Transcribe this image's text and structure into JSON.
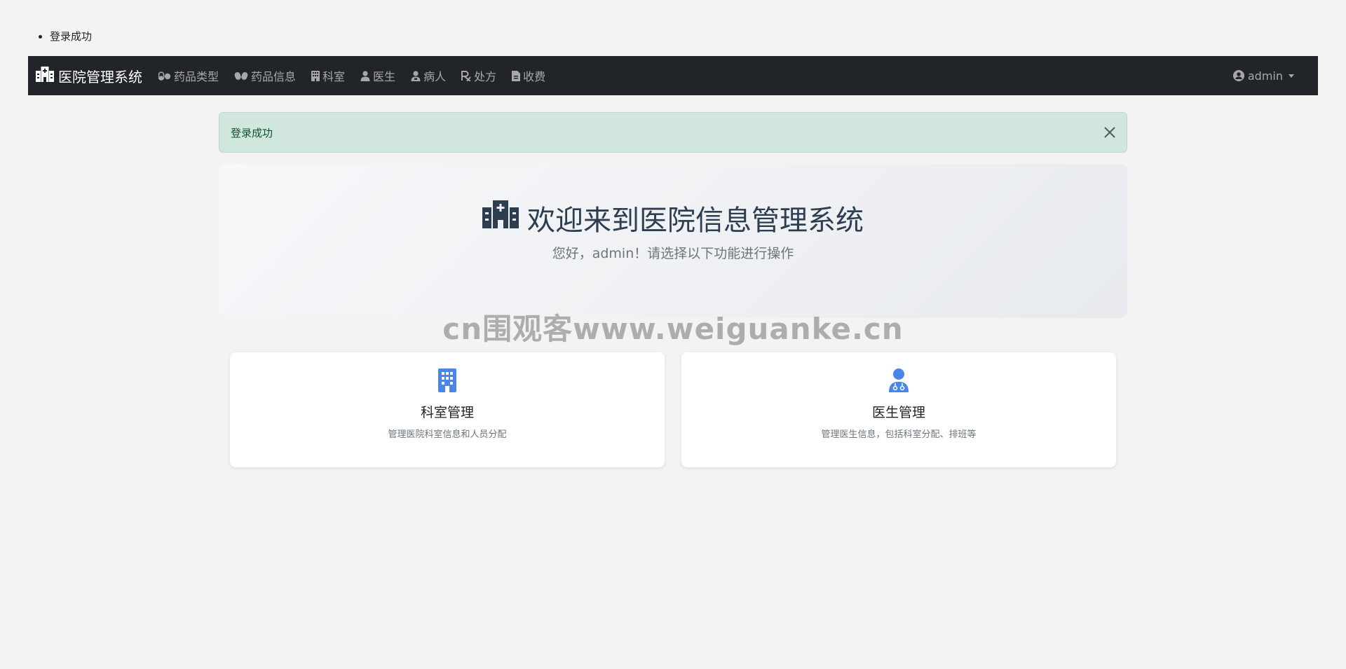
{
  "flash": {
    "messages": [
      "登录成功"
    ]
  },
  "navbar": {
    "brand": "医院管理系统",
    "items": [
      {
        "label": "药品类型",
        "icon": "pills-icon"
      },
      {
        "label": "药品信息",
        "icon": "capsules-icon"
      },
      {
        "label": "科室",
        "icon": "building-icon"
      },
      {
        "label": "医生",
        "icon": "user-doctor-icon"
      },
      {
        "label": "病人",
        "icon": "user-injured-icon"
      },
      {
        "label": "处方",
        "icon": "prescription-icon"
      },
      {
        "label": "收费",
        "icon": "invoice-icon"
      }
    ],
    "user": "admin"
  },
  "alert": {
    "text": "登录成功"
  },
  "hero": {
    "title": "欢迎来到医院信息管理系统",
    "subtitle": "您好，admin！请选择以下功能进行操作"
  },
  "watermark": "cn围观客www.weiguanke.cn",
  "cards": [
    {
      "title": "科室管理",
      "desc": "管理医院科室信息和人员分配",
      "icon": "building-icon"
    },
    {
      "title": "医生管理",
      "desc": "管理医生信息，包括科室分配、排班等",
      "icon": "user-doctor-icon"
    }
  ],
  "colors": {
    "navbar_bg": "#212529",
    "alert_bg": "#d1e7dd",
    "alert_text": "#0f5132",
    "card_icon": "#4a86e8",
    "page_bg": "#f3f3f3"
  }
}
